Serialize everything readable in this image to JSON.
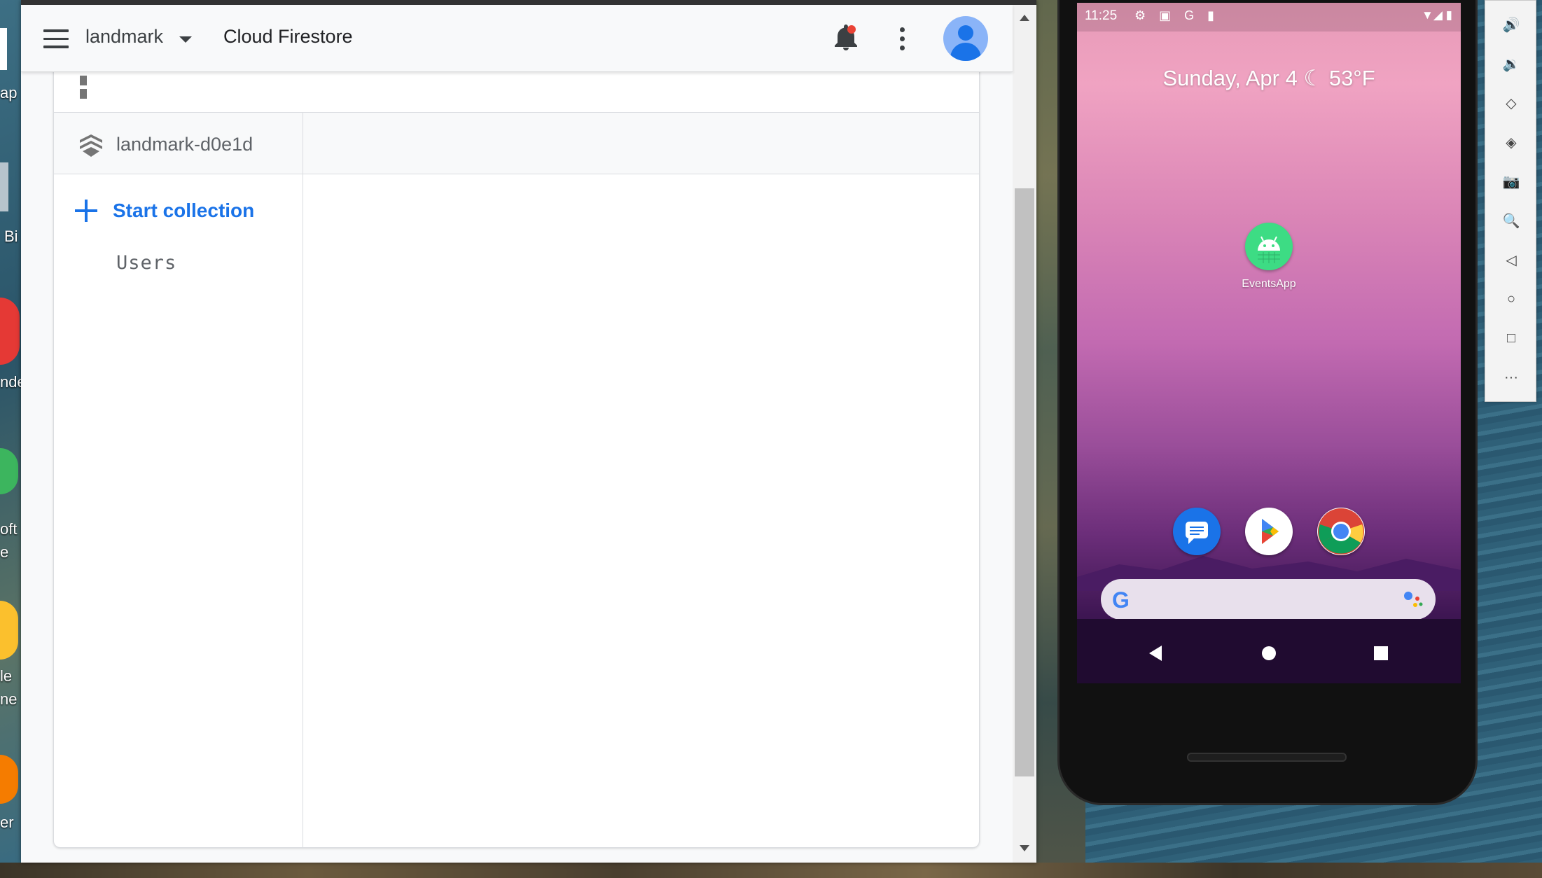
{
  "desktop": {
    "icon_labels": [
      "ap",
      "Bi",
      "nde",
      "oft",
      "e",
      "le",
      "ne",
      "er"
    ]
  },
  "browser": {
    "header": {
      "project_name": "landmark",
      "product_title": "Cloud Firestore"
    },
    "firestore": {
      "database_name": "landmark-d0e1d",
      "start_collection_label": "Start collection",
      "collections": [
        "Users"
      ]
    }
  },
  "emulator": {
    "status_time": "11:25",
    "status_icons": "⚙ ▣ G ▮",
    "status_right": "▼◢ ▮",
    "date_widget": "Sunday, Apr 4 ☾ 53°F",
    "app_label": "EventsApp",
    "toolbar": [
      "🔊",
      "🔉",
      "◇",
      "◈",
      "📷",
      "🔍",
      "◁",
      "○",
      "□",
      "···"
    ]
  },
  "colors": {
    "accent": "#1a73e8",
    "notification_dot": "#ea4335",
    "android_green": "#3ddc84"
  }
}
